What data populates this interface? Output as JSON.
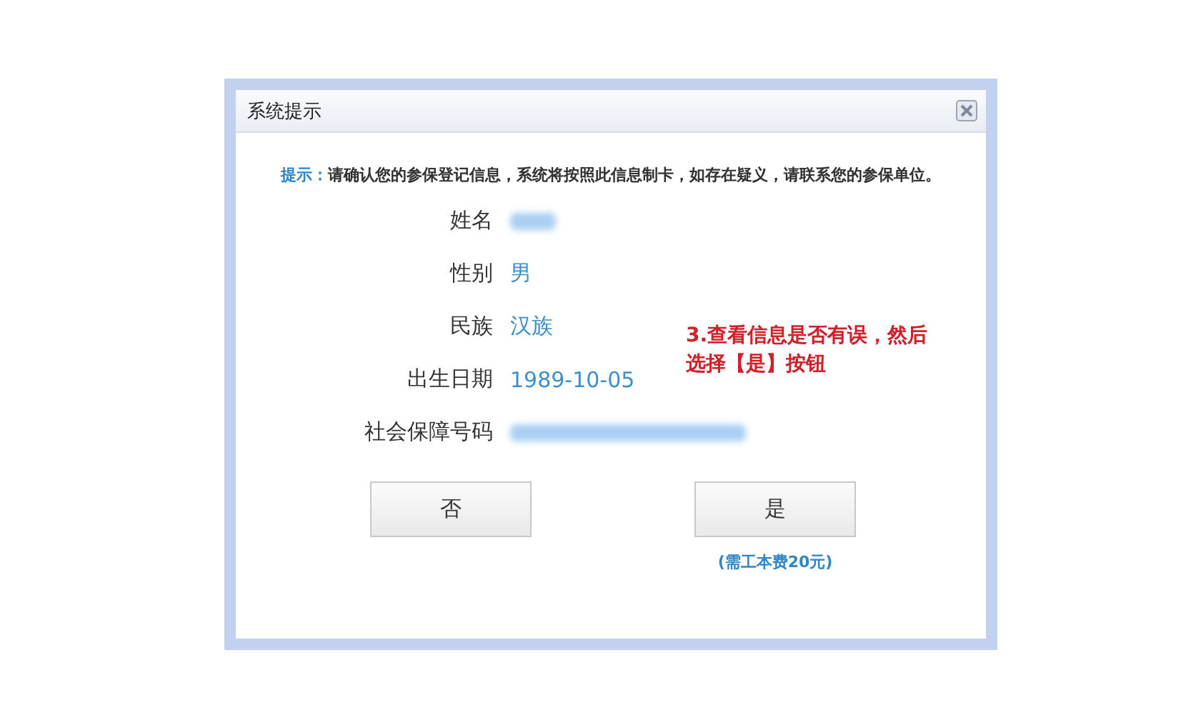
{
  "dialog": {
    "title": "系统提示",
    "hint": {
      "label": "提示：",
      "text": "请确认您的参保登记信息，系统将按照此信息制卡，如存在疑义，请联系您的参保单位。"
    },
    "fields": [
      {
        "label": "姓名",
        "kind": "blurshort"
      },
      {
        "label": "性别",
        "kind": "text",
        "value": "男"
      },
      {
        "label": "民族",
        "kind": "text",
        "value": "汉族"
      },
      {
        "label": "出生日期",
        "kind": "text",
        "value": "1989-10-05"
      },
      {
        "label": "社会保障号码",
        "kind": "blurlong"
      }
    ],
    "annotation": "3.查看信息是否有误，然后选择【是】按钮",
    "buttons": [
      {
        "label": "否"
      },
      {
        "label": "是",
        "note": "(需工本费20元)"
      }
    ]
  }
}
